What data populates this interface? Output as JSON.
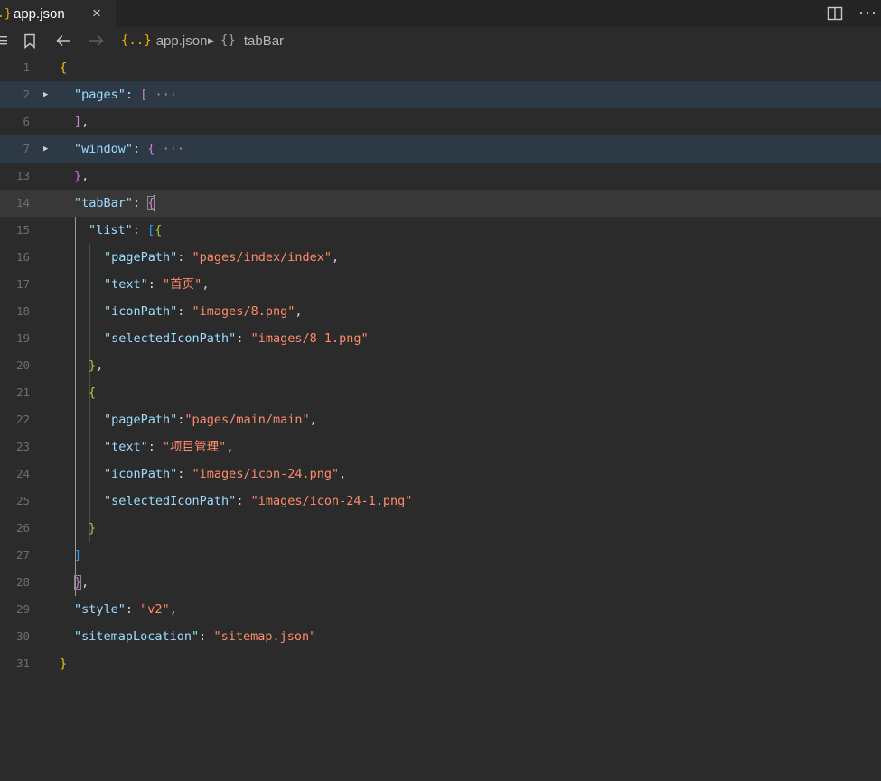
{
  "tab": {
    "icon": "{}",
    "label": "app.json",
    "close": "×"
  },
  "toolbar": {
    "more": "···"
  },
  "breadcrumb": {
    "file_icon": "{..}",
    "file": "app.json",
    "obj_icon": "{}",
    "symbol": "tabBar"
  },
  "editor": {
    "lines": [
      {
        "n": "1"
      },
      {
        "n": "2"
      },
      {
        "n": "6"
      },
      {
        "n": "7"
      },
      {
        "n": "13"
      },
      {
        "n": "14"
      },
      {
        "n": "15"
      },
      {
        "n": "16"
      },
      {
        "n": "17"
      },
      {
        "n": "18"
      },
      {
        "n": "19"
      },
      {
        "n": "20"
      },
      {
        "n": "21"
      },
      {
        "n": "22"
      },
      {
        "n": "23"
      },
      {
        "n": "24"
      },
      {
        "n": "25"
      },
      {
        "n": "26"
      },
      {
        "n": "27"
      },
      {
        "n": "28"
      },
      {
        "n": "29"
      },
      {
        "n": "30"
      },
      {
        "n": "31"
      }
    ],
    "t": {
      "q": "\"",
      "colon": ": ",
      "colon_nospace": ":",
      "comma": ",",
      "open_brace": "{",
      "close_brace": "}",
      "open_bracket": "[",
      "close_bracket": "]",
      "ellipsis": "···",
      "k_pages": "\"pages\"",
      "k_window": "\"window\"",
      "k_tabbar": "\"tabBar\"",
      "k_list": "\"list\"",
      "k_pagepath": "\"pagePath\"",
      "k_text": "\"text\"",
      "k_iconpath": "\"iconPath\"",
      "k_selected": "\"selectedIconPath\"",
      "k_style": "\"style\"",
      "k_sitemap": "\"sitemapLocation\"",
      "v_index": "\"pages/index/index\"",
      "v_home": "\"首页\"",
      "v_img8": "\"images/8.png\"",
      "v_img81": "\"images/8-1.png\"",
      "v_main": "\"pages/main/main\"",
      "v_proj": "\"项目管理\"",
      "v_icon24": "\"images/icon-24.png\"",
      "v_icon241": "\"images/icon-24-1.png\"",
      "v_v2": "\"v2\"",
      "v_sitemap": "\"sitemap.json\""
    }
  },
  "colors": {
    "background": "#2b2b2b",
    "key": "#9cdcfe",
    "string": "#ff8b6b",
    "bracket1": "#f2c40f",
    "bracket2": "#d37bdb",
    "bracket3": "#2f9cf0",
    "bracket4": "#a4d037"
  }
}
